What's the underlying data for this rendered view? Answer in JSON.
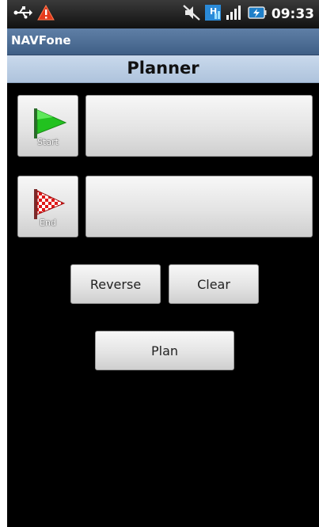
{
  "status_bar": {
    "time": "09:33",
    "icons": [
      "usb-icon",
      "warning-icon",
      "mute-icon",
      "hsdpa-icon",
      "signal-icon",
      "battery-icon"
    ]
  },
  "app": {
    "title": "NAVFone"
  },
  "planner": {
    "title": "Planner",
    "start": {
      "caption": "Start",
      "icon": "green-flag-icon",
      "value": ""
    },
    "end": {
      "caption": "End",
      "icon": "checkered-flag-icon",
      "value": ""
    },
    "reverse_label": "Reverse",
    "clear_label": "Clear",
    "plan_label": "Plan"
  },
  "colors": {
    "appbar": "#4a6a92",
    "header": "#bdd0e6",
    "background": "#000000"
  }
}
